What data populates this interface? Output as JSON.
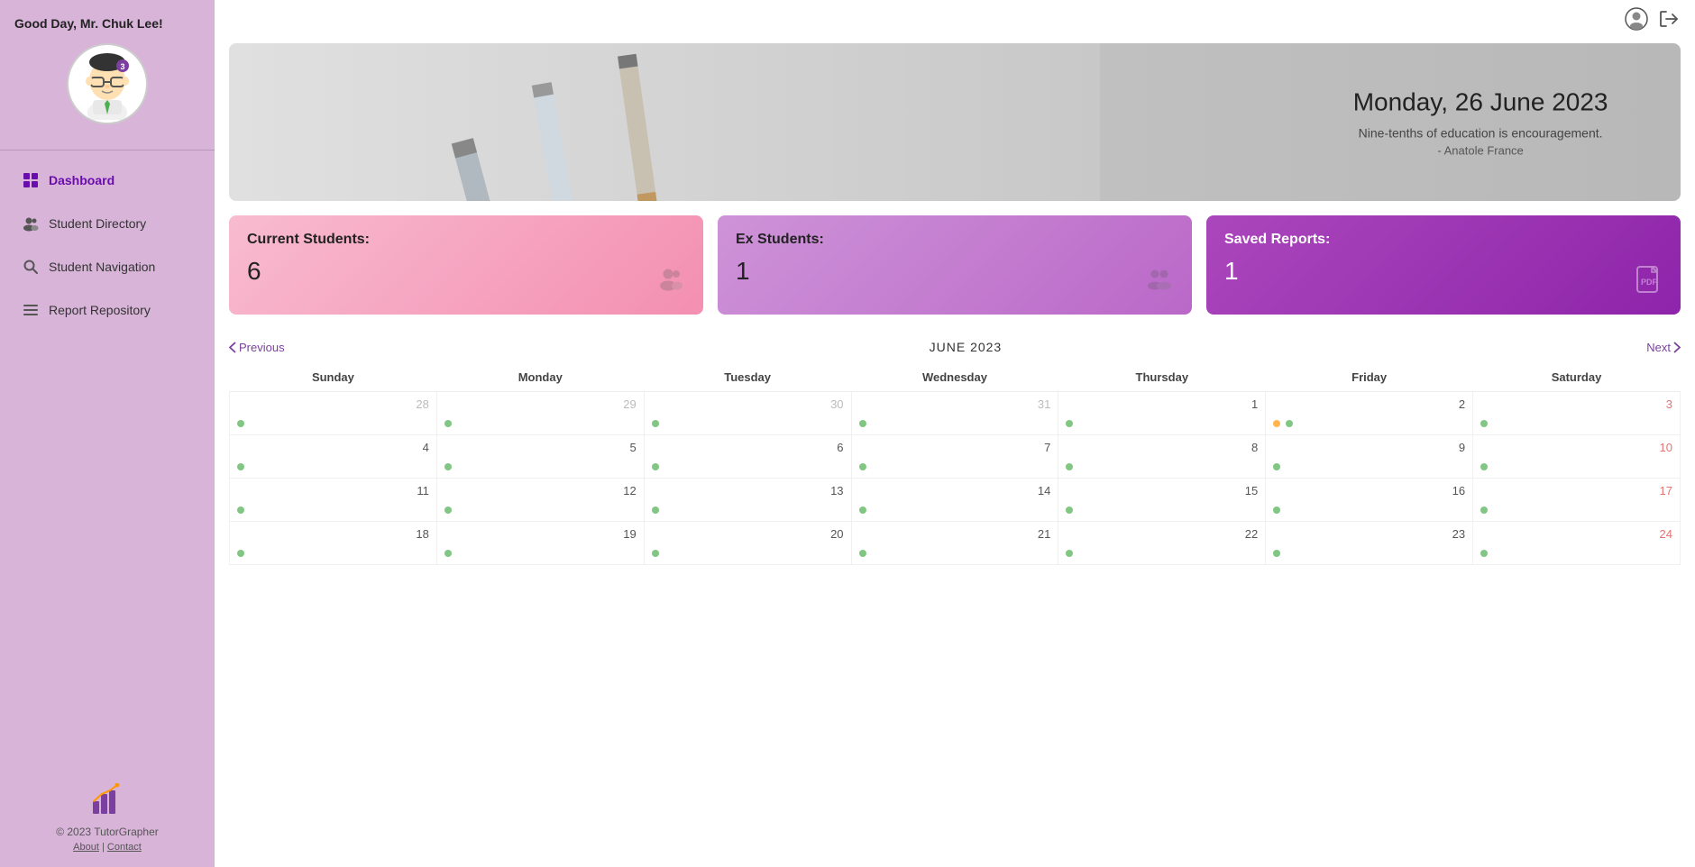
{
  "sidebar": {
    "greeting": "Good Day, Mr. Chuk Lee!",
    "nav_items": [
      {
        "id": "dashboard",
        "label": "Dashboard",
        "icon": "grid",
        "active": true
      },
      {
        "id": "student-directory",
        "label": "Student Directory",
        "icon": "people",
        "active": false
      },
      {
        "id": "student-navigation",
        "label": "Student Navigation",
        "icon": "search",
        "active": false
      },
      {
        "id": "report-repository",
        "label": "Report Repository",
        "icon": "list",
        "active": false
      }
    ],
    "footer": {
      "copyright": "© 2023 TutorGrapher",
      "about_label": "About",
      "contact_label": "Contact"
    }
  },
  "header": {
    "profile_icon": "person",
    "logout_icon": "logout"
  },
  "banner": {
    "date": "Monday, 26 June 2023",
    "quote": "Nine-tenths of education is encouragement.",
    "author": "- Anatole France"
  },
  "stats": [
    {
      "id": "current-students",
      "label": "Current Students:",
      "value": "6",
      "icon": "people",
      "color": "pink"
    },
    {
      "id": "ex-students",
      "label": "Ex Students:",
      "value": "1",
      "icon": "people-ex",
      "color": "purple-light"
    },
    {
      "id": "saved-reports",
      "label": "Saved Reports:",
      "value": "1",
      "icon": "pdf",
      "color": "purple-dark"
    }
  ],
  "calendar": {
    "title": "JUNE 2023",
    "prev_label": "Previous",
    "next_label": "Next",
    "days_of_week": [
      "Sunday",
      "Monday",
      "Tuesday",
      "Wednesday",
      "Thursday",
      "Friday",
      "Saturday"
    ],
    "weeks": [
      [
        {
          "num": "28",
          "type": "other-month",
          "dots": [
            "green"
          ]
        },
        {
          "num": "29",
          "type": "other-month",
          "dots": [
            "green"
          ]
        },
        {
          "num": "30",
          "type": "other-month",
          "dots": [
            "green"
          ]
        },
        {
          "num": "31",
          "type": "other-month",
          "dots": [
            "green"
          ]
        },
        {
          "num": "1",
          "type": "normal",
          "dots": [
            "green"
          ]
        },
        {
          "num": "2",
          "type": "normal",
          "dots": [
            "orange",
            "green"
          ]
        },
        {
          "num": "3",
          "type": "weekend",
          "dots": [
            "green"
          ]
        }
      ],
      [
        {
          "num": "4",
          "type": "normal",
          "dots": [
            "green"
          ]
        },
        {
          "num": "5",
          "type": "normal",
          "dots": [
            "green"
          ]
        },
        {
          "num": "6",
          "type": "normal",
          "dots": [
            "green"
          ]
        },
        {
          "num": "7",
          "type": "normal",
          "dots": [
            "green"
          ]
        },
        {
          "num": "8",
          "type": "normal",
          "dots": [
            "green"
          ]
        },
        {
          "num": "9",
          "type": "normal",
          "dots": [
            "green"
          ]
        },
        {
          "num": "10",
          "type": "weekend",
          "dots": [
            "green"
          ]
        }
      ],
      [
        {
          "num": "11",
          "type": "normal",
          "dots": [
            "green"
          ]
        },
        {
          "num": "12",
          "type": "normal",
          "dots": [
            "green"
          ]
        },
        {
          "num": "13",
          "type": "normal",
          "dots": [
            "green"
          ]
        },
        {
          "num": "14",
          "type": "normal",
          "dots": [
            "green"
          ]
        },
        {
          "num": "15",
          "type": "normal",
          "dots": [
            "green"
          ]
        },
        {
          "num": "16",
          "type": "normal",
          "dots": [
            "green"
          ]
        },
        {
          "num": "17",
          "type": "weekend",
          "dots": [
            "green"
          ]
        }
      ],
      [
        {
          "num": "18",
          "type": "normal",
          "dots": [
            "green"
          ]
        },
        {
          "num": "19",
          "type": "normal",
          "dots": [
            "green"
          ]
        },
        {
          "num": "20",
          "type": "normal",
          "dots": [
            "green"
          ]
        },
        {
          "num": "21",
          "type": "normal",
          "dots": [
            "green"
          ]
        },
        {
          "num": "22",
          "type": "normal",
          "dots": [
            "green"
          ]
        },
        {
          "num": "23",
          "type": "normal",
          "dots": [
            "green"
          ]
        },
        {
          "num": "24",
          "type": "weekend",
          "dots": [
            "green"
          ]
        }
      ]
    ]
  }
}
